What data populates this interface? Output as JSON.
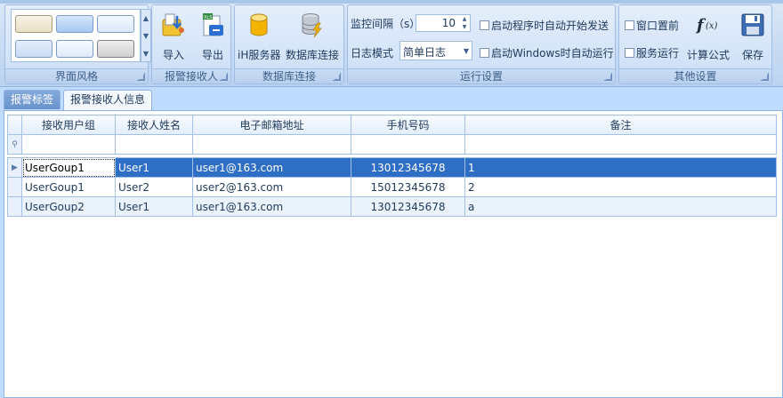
{
  "ribbon": {
    "groups": {
      "style": "界面风格",
      "receivers": "报警接收人",
      "db": "数据库连接",
      "runtime": "运行设置",
      "other": "其他设置"
    },
    "buttons": {
      "import": "导入",
      "export": "导出",
      "ih_server": "iH服务器",
      "db_connect": "数据库连接",
      "formula": "计算公式",
      "save": "保存"
    },
    "runtime": {
      "interval_label": "监控间隔（s）",
      "interval_value": "10",
      "log_mode_label": "日志模式",
      "log_mode_value": "简单日志",
      "auto_send": "启动程序时自动开始发送",
      "auto_run_windows": "启动Windows时自动运行"
    },
    "other": {
      "window_top": "窗口置前",
      "service_run": "服务运行"
    }
  },
  "tabs": [
    "报警标签",
    "报警接收人信息"
  ],
  "grid": {
    "columns": [
      "接收用户组",
      "接收人姓名",
      "电子邮箱地址",
      "手机号码",
      "备注"
    ],
    "rows": [
      [
        "UserGoup1",
        "User1",
        "user1@163.com",
        "13012345678",
        "1"
      ],
      [
        "UserGoup1",
        "User2",
        "user2@163.com",
        "15012345678",
        "2"
      ],
      [
        "UserGoup2",
        "User1",
        "user1@163.com",
        "13012345678",
        "a"
      ]
    ]
  },
  "colors": {
    "selection": "#2f6ec5",
    "ribbon": "#c6daf3",
    "background": "#bfdbff"
  }
}
